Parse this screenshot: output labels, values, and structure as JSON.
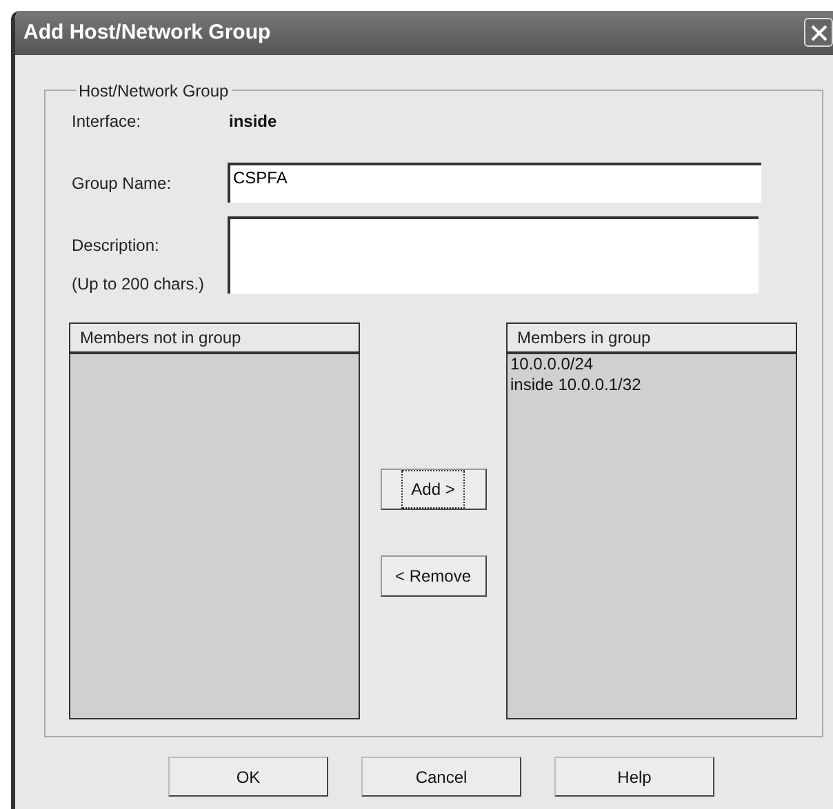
{
  "window": {
    "title": "Add Host/Network Group"
  },
  "group_box": {
    "title": "Host/Network Group",
    "interface": {
      "label": "Interface:",
      "value": "inside"
    },
    "group_name": {
      "label": "Group Name:",
      "value": "CSPFA"
    },
    "description": {
      "label": "Description:",
      "hint": "(Up to 200 chars.)"
    }
  },
  "lists": [
    {
      "header": "Members not in group"
    },
    {
      "header": "Members in group",
      "items": [
        "10.0.0.0/24",
        "inside 10.0.0.1/32"
      ]
    }
  ],
  "move_buttons": [
    {
      "label": "Add >",
      "focused": true
    },
    {
      "label": "< Remove",
      "focused": false
    }
  ],
  "buttons": [
    "OK",
    "Cancel",
    "Help"
  ]
}
